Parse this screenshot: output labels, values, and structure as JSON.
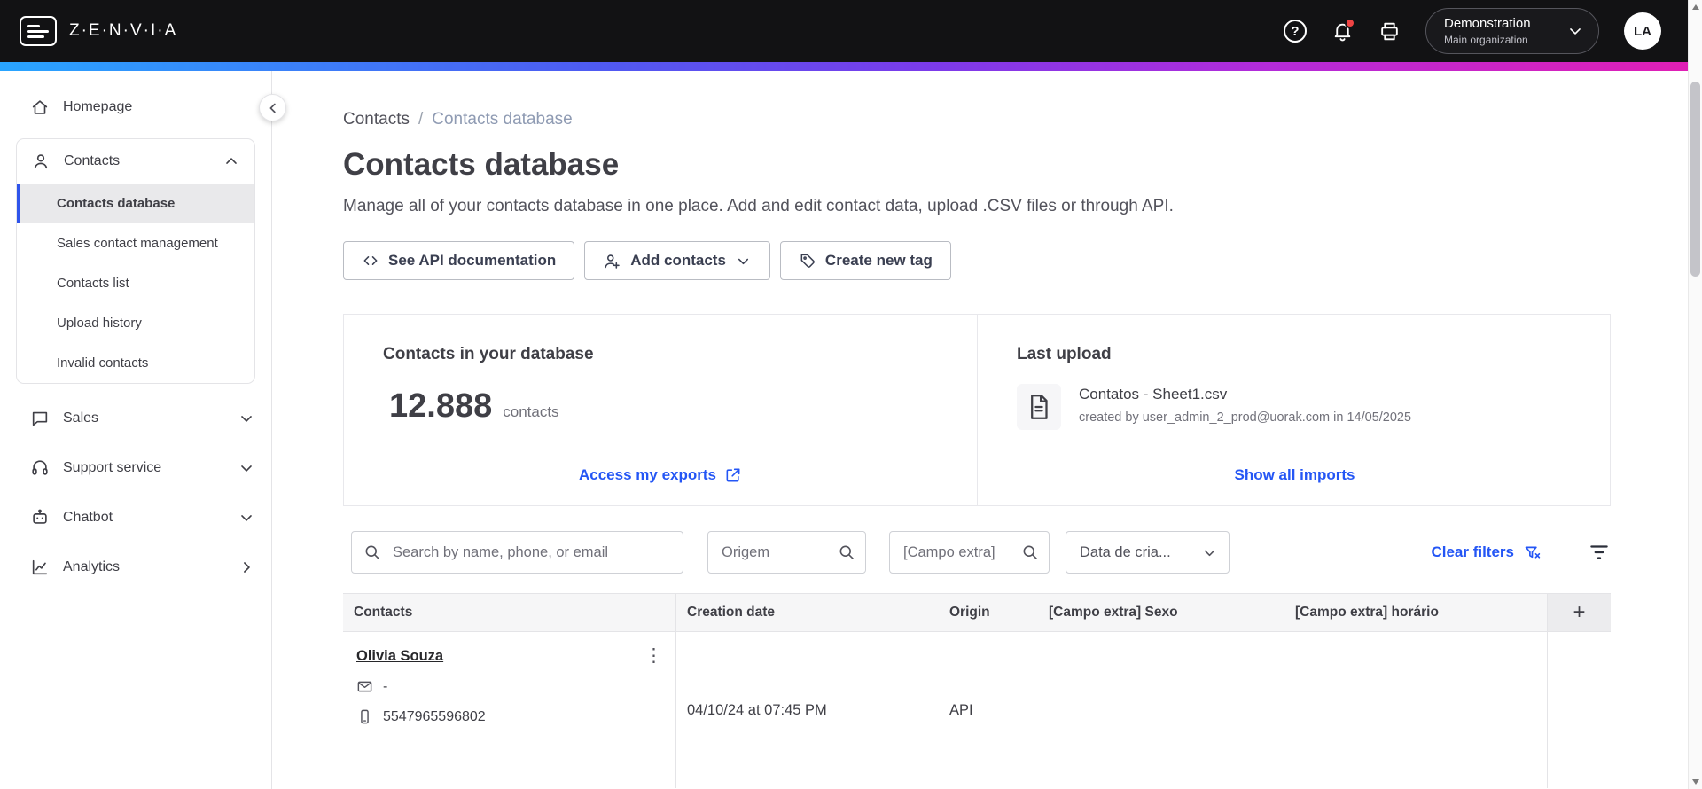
{
  "topbar": {
    "brand": "Z·E·N·V·I·A",
    "org_name": "Demonstration",
    "org_sub": "Main organization",
    "avatar": "LA"
  },
  "icons": {
    "help": "?",
    "kebab": "⋮"
  },
  "sidebar": {
    "homepage": "Homepage",
    "contacts": "Contacts",
    "contacts_children": [
      "Contacts database",
      "Sales contact management",
      "Contacts list",
      "Upload history",
      "Invalid contacts"
    ],
    "sales": "Sales",
    "support": "Support service",
    "chatbot": "Chatbot",
    "analytics": "Analytics"
  },
  "breadcrumb": {
    "parent": "Contacts",
    "separator": "/",
    "current": "Contacts database"
  },
  "page": {
    "title": "Contacts database",
    "subtitle": "Manage all of your contacts database in one place. Add and edit contact data, upload .CSV files or through API."
  },
  "actions": {
    "api_docs": "See API documentation",
    "add_contacts": "Add contacts",
    "create_tag": "Create new tag"
  },
  "stats": {
    "title": "Contacts in your database",
    "count": "12.888",
    "unit": "contacts",
    "link": "Access my exports"
  },
  "upload": {
    "title": "Last upload",
    "file_name": "Contatos - Sheet1.csv",
    "meta": "created by user_admin_2_prod@uorak.com in 14/05/2025",
    "link": "Show all imports"
  },
  "filters": {
    "search_placeholder": "Search by name, phone, or email",
    "origin_placeholder": "Origem",
    "extra_placeholder": "[Campo extra]",
    "date_label": "Data de cria...",
    "clear": "Clear filters"
  },
  "table": {
    "headers": [
      "Contacts",
      "Creation date",
      "Origin",
      "[Campo extra] Sexo",
      "[Campo extra] horário"
    ],
    "add_column": "+",
    "rows": [
      {
        "name": "Olivia Souza",
        "email": "-",
        "phone": "5547965596802",
        "creation_date": "04/10/24 at 07:45 PM",
        "origin": "API",
        "sexo": "",
        "horario": ""
      }
    ]
  },
  "colors": {
    "topbar_bg": "#121214",
    "accent_blue": "#2456F5",
    "selected_bar_blue": "#2F54EB",
    "notification_red": "#EF4444",
    "gradient": [
      "#29A5FF",
      "#4E5BF2",
      "#7B3BEA",
      "#B32BD9",
      "#E01FB5"
    ]
  }
}
